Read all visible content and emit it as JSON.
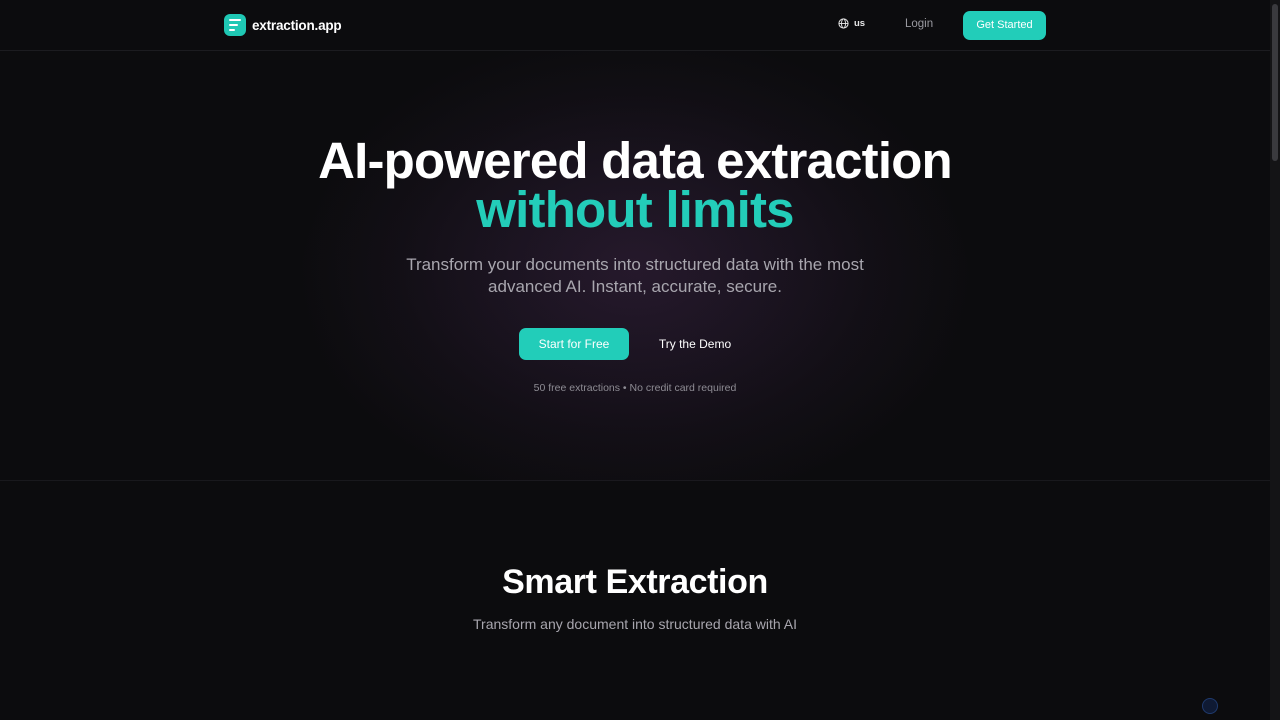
{
  "header": {
    "logo_text": "extraction.app",
    "language_label": "us",
    "login_label": "Login",
    "get_started_label": "Get Started"
  },
  "hero": {
    "title_line1": "AI-powered data extraction",
    "title_line2": "without limits",
    "subtitle": "Transform your documents into structured data with the most advanced AI. Instant, accurate, secure.",
    "primary_cta": "Start for Free",
    "secondary_cta": "Try the Demo",
    "note": "50 free extractions • No credit card required"
  },
  "features": {
    "title": "Smart Extraction",
    "subtitle": "Transform any document into structured data with AI"
  },
  "colors": {
    "accent": "#22cdb9",
    "background": "#0c0c0e",
    "muted_text": "#a8a6ae"
  },
  "icons": {
    "logo": "document-lines-icon",
    "language": "globe-icon"
  }
}
